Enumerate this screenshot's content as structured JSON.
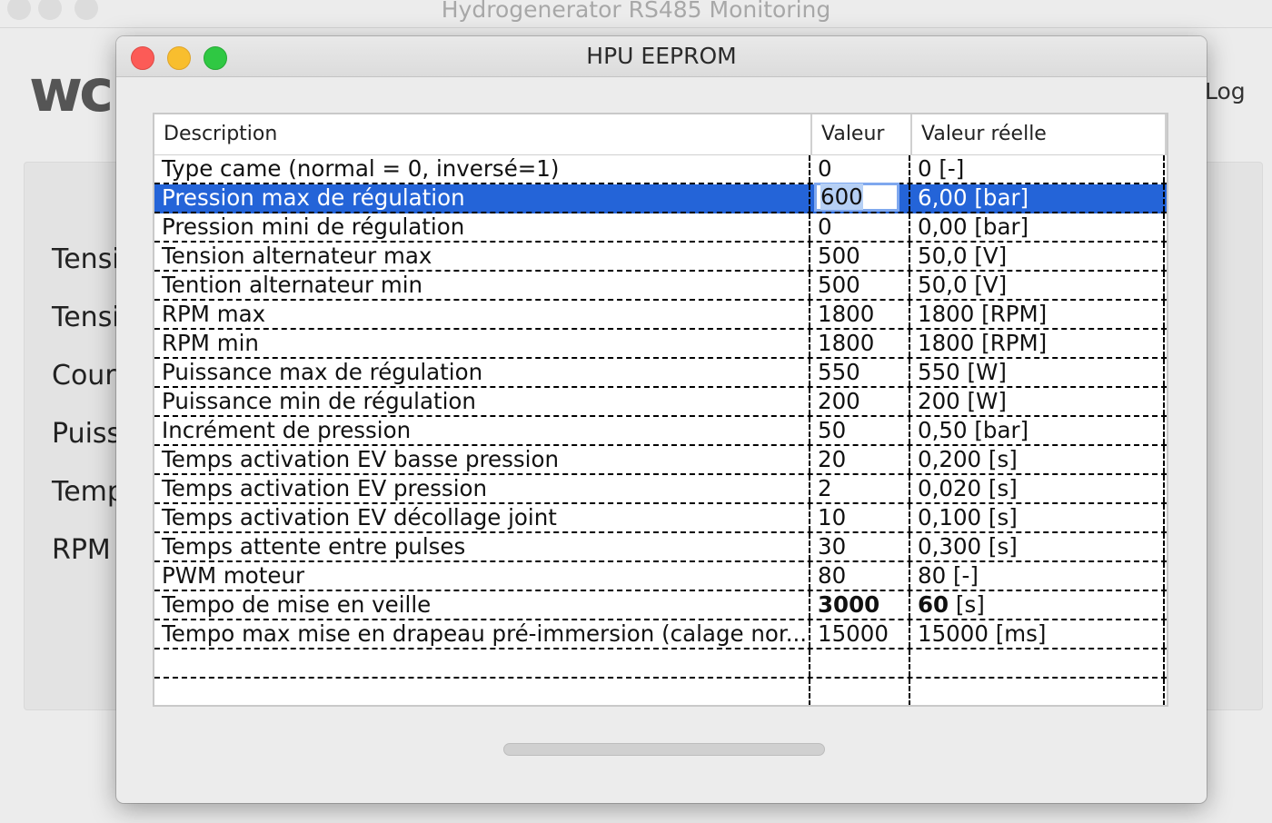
{
  "main_window": {
    "title": "Hydrogenerator RS485 Monitoring",
    "logo_text": "wc",
    "log_button": "Log",
    "labels": [
      "Tensi",
      "Tensi",
      "Cour",
      "Puiss",
      "Temp",
      "RPM"
    ]
  },
  "dialog": {
    "title": "HPU EEPROM",
    "columns": {
      "description": "Description",
      "value": "Valeur",
      "real_value": "Valeur réelle"
    },
    "rows": [
      {
        "description": "Type came (normal = 0, inversé=1)",
        "value": "0",
        "real_value": "0 [-]"
      },
      {
        "description": "Pression max de régulation",
        "value": "600",
        "real_value": "6,00 [bar]",
        "selected": true,
        "editing": true
      },
      {
        "description": "Pression mini de régulation",
        "value": "0",
        "real_value": "0,00 [bar]"
      },
      {
        "description": "Tension alternateur max",
        "value": "500",
        "real_value": "50,0 [V]"
      },
      {
        "description": "Tention alternateur min",
        "value": "500",
        "real_value": "50,0 [V]"
      },
      {
        "description": "RPM max",
        "value": "1800",
        "real_value": "1800 [RPM]"
      },
      {
        "description": "RPM min",
        "value": "1800",
        "real_value": "1800 [RPM]"
      },
      {
        "description": "Puissance max de régulation",
        "value": "550",
        "real_value": "550 [W]"
      },
      {
        "description": "Puissance min de régulation",
        "value": "200",
        "real_value": "200 [W]"
      },
      {
        "description": "Incrément de pression",
        "value": "50",
        "real_value": "0,50 [bar]"
      },
      {
        "description": "Temps activation EV basse pression",
        "value": "20",
        "real_value": "0,200 [s]"
      },
      {
        "description": "Temps activation EV pression",
        "value": "2",
        "real_value": "0,020 [s]"
      },
      {
        "description": "Temps activation EV décollage joint",
        "value": "10",
        "real_value": "0,100 [s]"
      },
      {
        "description": "Temps attente entre pulses",
        "value": "30",
        "real_value": "0,300 [s]"
      },
      {
        "description": "PWM moteur",
        "value": "80",
        "real_value": "80 [-]"
      },
      {
        "description": "Tempo de mise en veille",
        "value": "3000",
        "real_value_bold": "60",
        "real_value": " [s]",
        "bold": true
      },
      {
        "description": "Tempo max mise en drapeau pré-immersion (calage nor...",
        "value": "15000",
        "real_value": "15000 [ms]"
      },
      {
        "description": "",
        "value": "",
        "real_value": ""
      },
      {
        "description": "",
        "value": "",
        "real_value": ""
      }
    ]
  }
}
